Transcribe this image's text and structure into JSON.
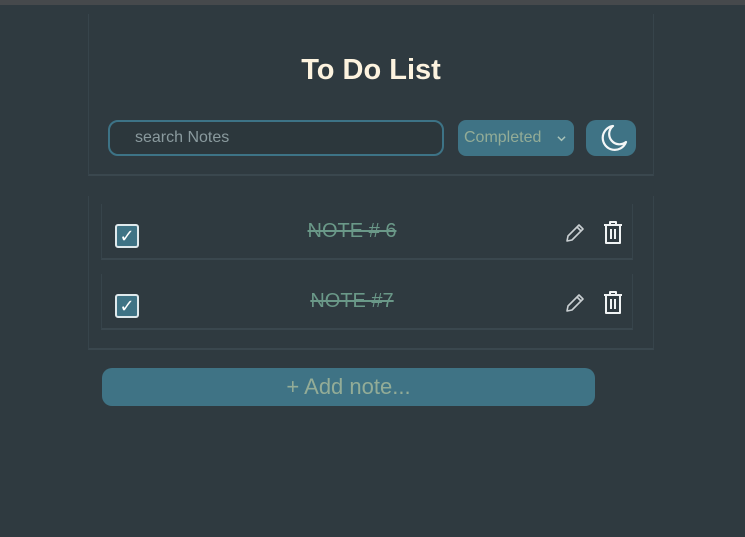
{
  "header": {
    "title": "To Do List"
  },
  "toolbar": {
    "search_placeholder": "search Notes",
    "search_value": "",
    "filter_selected": "Completed",
    "theme_toggle_icon": "moon-icon"
  },
  "notes": [
    {
      "label": "NOTE # 6",
      "checked": true
    },
    {
      "label": "NOTE #7",
      "checked": true
    }
  ],
  "icons": {
    "checkmark": "✓",
    "edit": "pencil-icon",
    "delete": "trash-icon"
  },
  "footer": {
    "add_label": "+ Add note..."
  },
  "colors": {
    "background": "#2f3a40",
    "accent": "#3f7385",
    "title": "#fdf3df",
    "completed_text": "#6a9888"
  }
}
